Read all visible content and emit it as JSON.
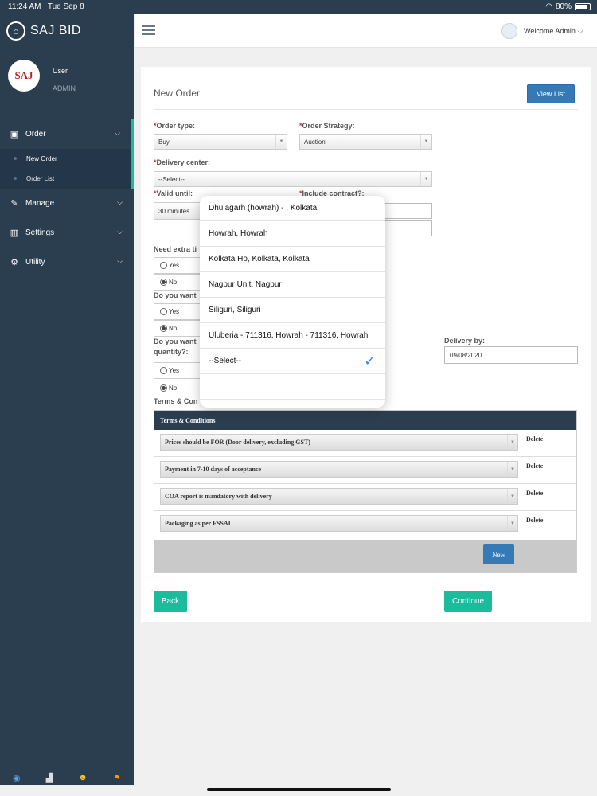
{
  "status_bar": {
    "time": "11:24 AM",
    "date": "Tue Sep 8",
    "battery": "80%"
  },
  "sidebar": {
    "brand": "SAJ BID",
    "avatar_text": "SAJ",
    "user_name": "User",
    "user_role": "ADMIN",
    "nav": [
      {
        "label": "Order",
        "icon": "briefcase-icon"
      },
      {
        "label": "Manage",
        "icon": "edit-icon"
      },
      {
        "label": "Settings",
        "icon": "bar-chart-icon"
      },
      {
        "label": "Utility",
        "icon": "gear-icon"
      }
    ],
    "sub_items": [
      {
        "label": "New Order",
        "active": true
      },
      {
        "label": "Order List",
        "active": false
      }
    ],
    "footer_icons": [
      "eye-icon",
      "toilet-icon",
      "emoji-icon",
      "surfer-icon"
    ]
  },
  "topbar": {
    "welcome": "Welcome Admin ⌵"
  },
  "page": {
    "title": "New Order",
    "view_list": "View List",
    "order_type": {
      "label": "Order type:",
      "value": "Buy"
    },
    "order_strategy": {
      "label": "Order Strategy:",
      "value": "Auction"
    },
    "delivery_center": {
      "label": "Delivery center:",
      "value": "--Select--"
    },
    "valid_until": {
      "label": "Valid until:",
      "value": "30 minutes"
    },
    "include_contract": {
      "label": "Include contract?:"
    },
    "need_extra": {
      "label": "Need extra ti",
      "yes": "Yes",
      "no": "No",
      "selected": "No"
    },
    "do_you_want_1": {
      "label": "Do you want",
      "yes": "Yes",
      "no": "No",
      "selected": "No"
    },
    "do_you_want_2": {
      "label_line1": "Do you want",
      "label_line2": "quantity?:",
      "yes": "Yes",
      "no": "No",
      "selected": "No"
    },
    "delivery_by": {
      "label": "Delivery by:",
      "value": "09/08/2020"
    },
    "terms_label": "Terms & Con",
    "terms": {
      "header": "Terms & Conditions",
      "rows": [
        "Prices should be FOR (Door delivery, excluding GST)",
        "Payment in 7-10 days of acceptance",
        "COA report is mandatory with delivery",
        "Packaging as per FSSAI"
      ],
      "delete_label": "Delete",
      "new_label": "New"
    },
    "back": "Back",
    "continue": "Continue"
  },
  "dropdown": {
    "options": [
      "Dhulagarh (howrah) - , Kolkata",
      "Howrah, Howrah",
      "Kolkata Ho, Kolkata, Kolkata",
      "Nagpur Unit, Nagpur",
      "Siliguri, Siliguri",
      "Uluberia - 711316, Howrah - 711316, Howrah",
      "--Select--"
    ],
    "selected_index": 6
  },
  "colors": {
    "sidebar_bg": "#2b3e50",
    "accent_green": "#1abc9c",
    "primary_blue": "#337ab7",
    "required_red": "#c9302c"
  }
}
